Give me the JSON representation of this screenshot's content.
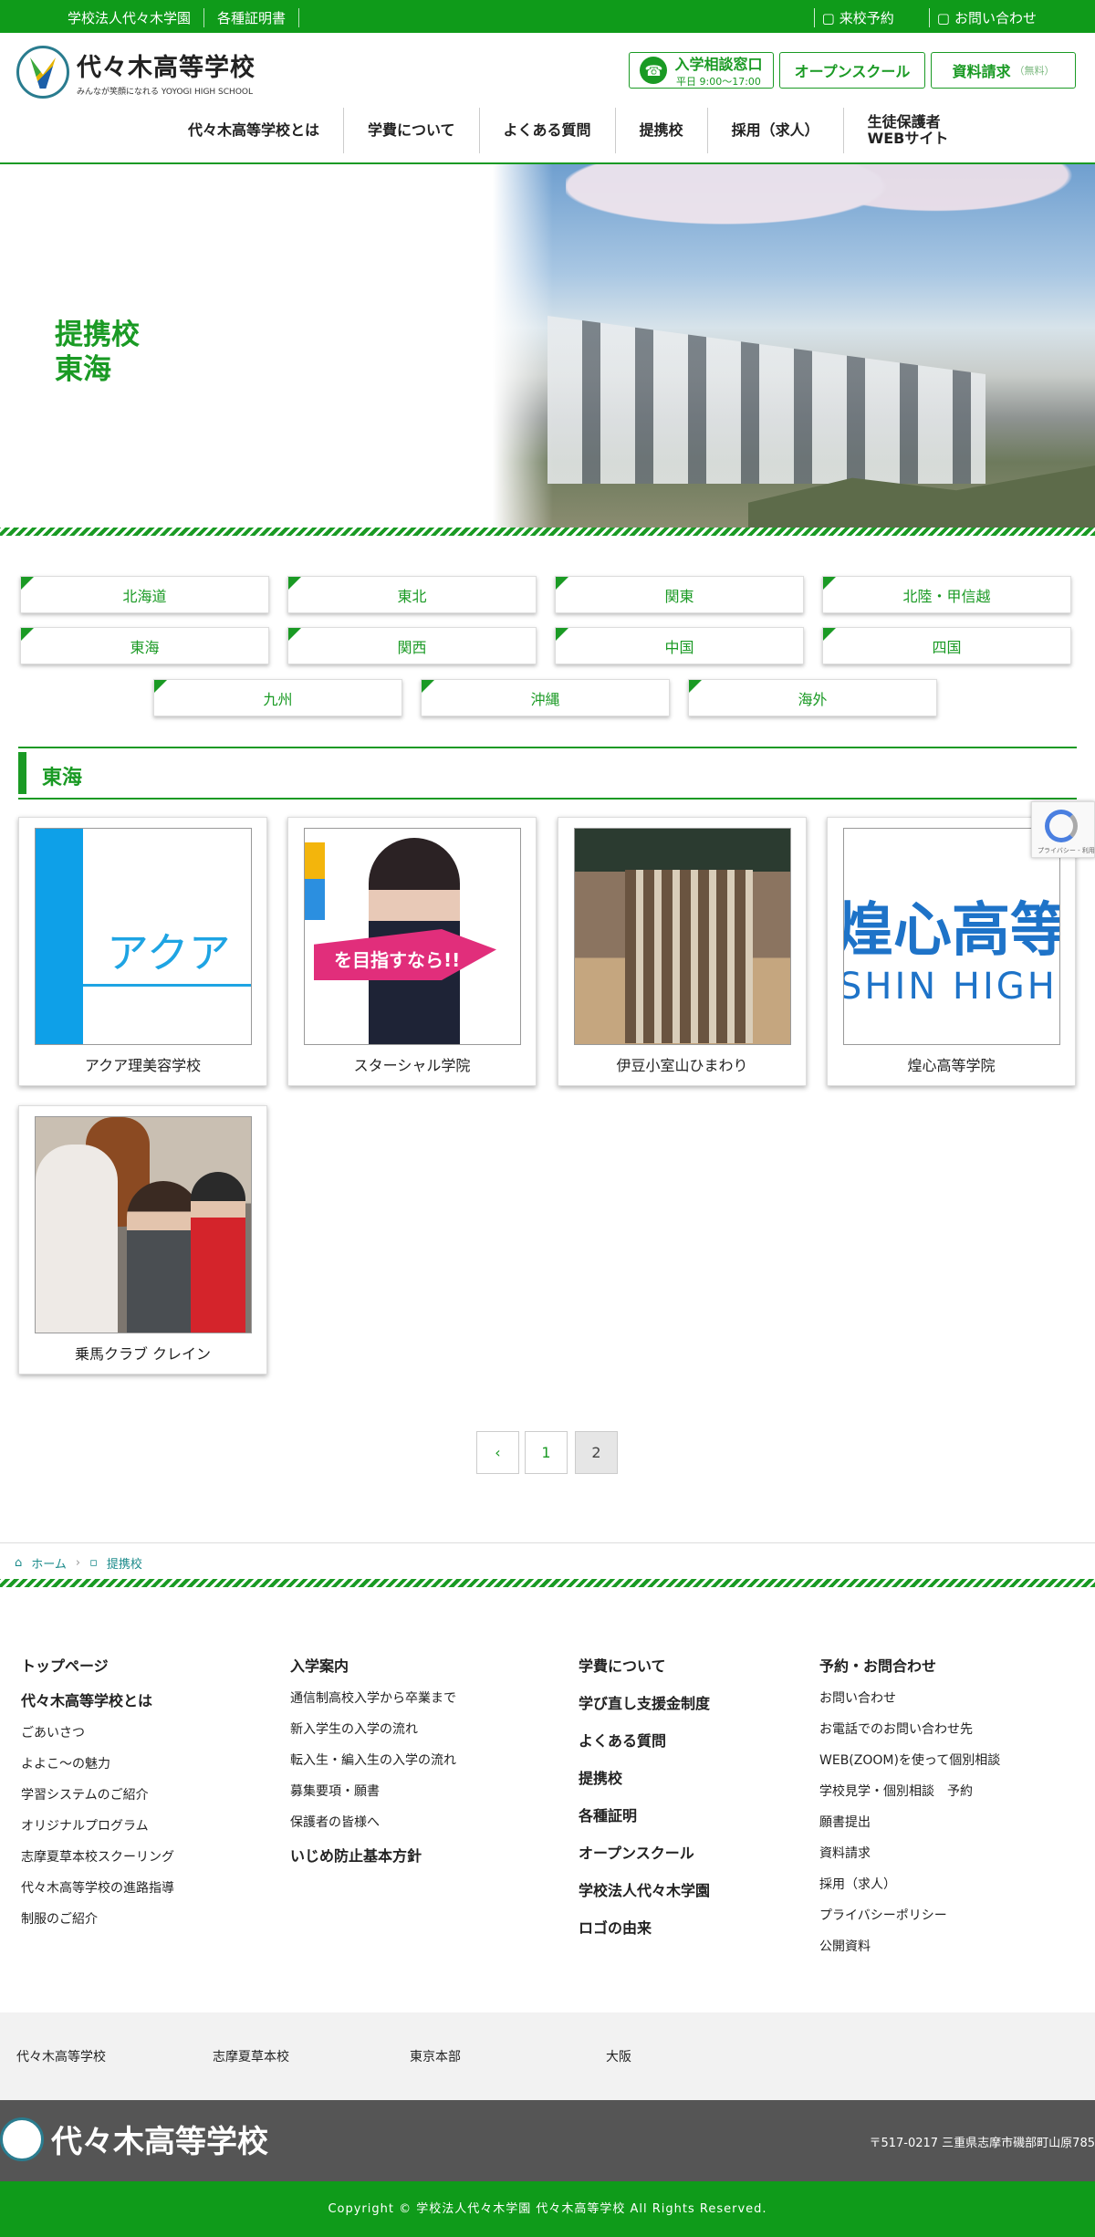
{
  "topbar": {
    "left_links": [
      "学校法人代々木学園",
      "各種証明書"
    ],
    "right_links": [
      "来校予約",
      "お問い合わせ"
    ]
  },
  "header": {
    "school_name": "代々木高等学校",
    "tagline": "みんなが笑顔になれる YOYOGI HIGH SCHOOL",
    "consult_label": "入学相談窓口",
    "consult_hours": "平日 9:00〜17:00",
    "open_school_label": "オープンスクール",
    "docs_label": "資料請求",
    "docs_note": "（無料）"
  },
  "nav": [
    "代々木高等学校とは",
    "学費について",
    "よくある質問",
    "提携校",
    "採用（求人）",
    "生徒保護者",
    "WEBサイト"
  ],
  "hero": {
    "line1": "提携校",
    "line2": "東海"
  },
  "regions_row1": [
    "北海道",
    "東北",
    "関東",
    "北陸・甲信越"
  ],
  "regions_row2": [
    "東海",
    "関西",
    "中国",
    "四国"
  ],
  "regions_row3": [
    "九州",
    "沖縄",
    "海外"
  ],
  "section_title": "東海",
  "cards": [
    {
      "label": "アクア理美容学校",
      "img_text": "アクア"
    },
    {
      "label": "スターシャル学院",
      "img_text": "を目指すなら!!"
    },
    {
      "label": "伊豆小室山ひまわり"
    },
    {
      "label": "煌心高等学院",
      "img_text": "煌心高等",
      "img_text2": "SHIN HIGH"
    },
    {
      "label": "乗馬クラブ クレイン"
    }
  ],
  "pagination": [
    "1",
    "2"
  ],
  "breadcrumb": [
    "ホーム",
    "提携校"
  ],
  "footer": {
    "col1": {
      "head": "トップページ",
      "sub": "代々木高等学校とは",
      "links": [
        "ごあいさつ",
        "よよこ〜の魅力",
        "学習システムのご紹介",
        "オリジナルプログラム",
        "志摩夏草本校スクーリング",
        "代々木高等学校の進路指導",
        "制服のご紹介"
      ]
    },
    "col2": {
      "head": "入学案内",
      "links": [
        "通信制高校入学から卒業まで",
        "新入学生の入学の流れ",
        "転入生・編入生の入学の流れ",
        "募集要項・願書",
        "保護者の皆様へ"
      ],
      "bold": "いじめ防止基本方針"
    },
    "col3": [
      "学費について",
      "学び直し支援金制度",
      "よくある質問",
      "提携校",
      "各種証明",
      "オープンスクール",
      "学校法人代々木学園",
      "ロゴの由来"
    ],
    "col4": {
      "head": "予約・お問合わせ",
      "links": [
        "お問い合わせ",
        "お電話でのお問い合わせ先",
        "WEB(ZOOM)を使って個別相談",
        "学校見学・個別相談　予約",
        "願書提出",
        "資料請求",
        "採用（求人）",
        "プライバシーポリシー",
        "公開資料"
      ]
    }
  },
  "campus": [
    "代々木高等学校",
    "志摩夏草本校",
    "東京本部",
    "大阪"
  ],
  "footer_logo": "代々木高等学校",
  "address": "〒517-0217 三重県志摩市磯部町山原785",
  "copyright": "Copyright © 学校法人代々木学園 代々木高等学校 All Rights Reserved.",
  "recaptcha": "プライバシー - 利用規約",
  "colors": {
    "brand_green": "#1a9a24"
  }
}
